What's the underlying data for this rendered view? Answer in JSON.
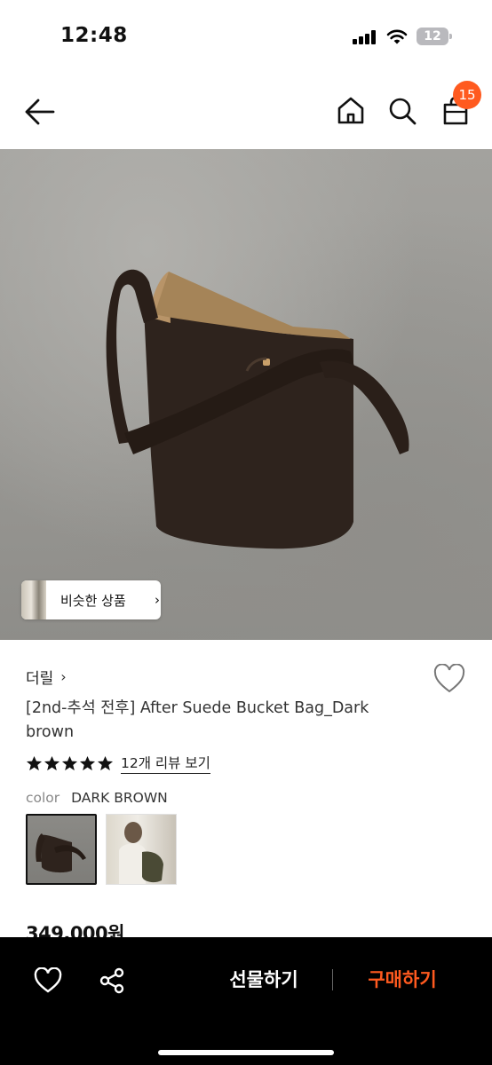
{
  "status_bar": {
    "time": "12:48",
    "battery_level": "12"
  },
  "nav": {
    "cart_count": "15"
  },
  "colors": {
    "accent": "#ff5a1f",
    "bottom_bar": "#000000"
  },
  "hero": {
    "similar_products_label": "비슷한 상품"
  },
  "product": {
    "brand": "더릴",
    "title": "[2nd-추석 전후] After Suede Bucket Bag_Dark brown",
    "rating": 5,
    "review_link": "12개 리뷰 보기",
    "color_key": "color",
    "color_value": "DARK BROWN",
    "price": "349,000원"
  },
  "bottom_bar": {
    "gift_label": "선물하기",
    "buy_label": "구매하기"
  }
}
